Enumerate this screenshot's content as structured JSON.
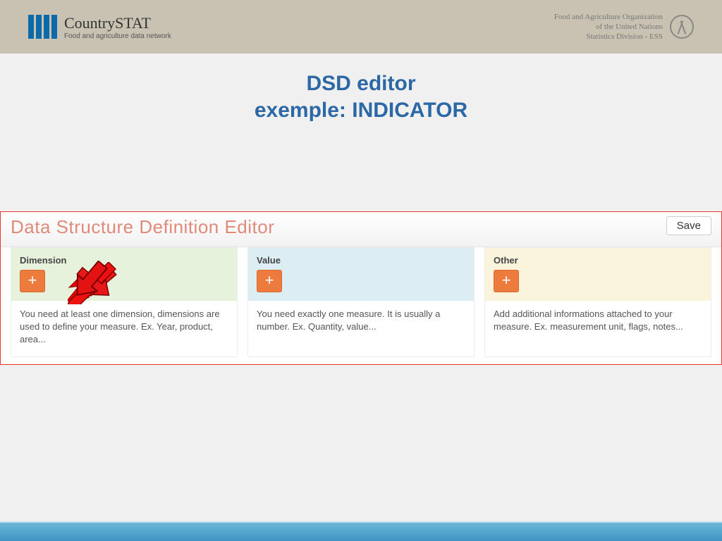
{
  "header": {
    "logo_title": "CountrySTAT",
    "logo_sub": "Food and agriculture data network",
    "fao_line1": "Food and Agriculture Organization",
    "fao_line2": "of the United Nations",
    "fao_line3": "Statistics Division - ESS",
    "fao_emblem": "FAO"
  },
  "title_line1": "DSD editor",
  "title_line2": "exemple: INDICATOR",
  "editor": {
    "title": "Data Structure Definition Editor",
    "save": "Save",
    "columns": [
      {
        "label": "Dimension",
        "add": "+",
        "desc": "You need at least one dimension, dimensions are used to define your measure.\nEx. Year, product, area..."
      },
      {
        "label": "Value",
        "add": "+",
        "desc": "You need exactly one measure. It is usually a number.\nEx. Quantity, value..."
      },
      {
        "label": "Other",
        "add": "+",
        "desc": "Add additional informations attached to your measure.\nEx. measurement unit, flags, notes..."
      }
    ]
  }
}
